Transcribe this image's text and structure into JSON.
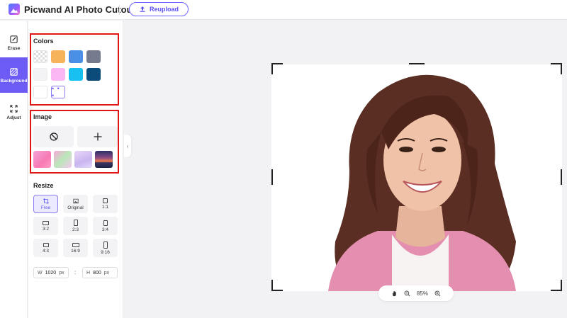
{
  "app": {
    "title": "Picwand AI Photo Cutout",
    "reupload_label": "Reupload"
  },
  "rail": [
    {
      "label": "Erase",
      "icon": "erase-icon"
    },
    {
      "label": "Background",
      "icon": "background-icon"
    },
    {
      "label": "Adjust",
      "icon": "adjust-icon"
    }
  ],
  "colors": {
    "title": "Colors",
    "swatches": [
      "transparent",
      "#f7b35c",
      "#4a8fe6",
      "#757b8c",
      "#f3f3f5",
      "#fbb7f3",
      "#17c0f0",
      "#0c4c7a",
      "#ffffff"
    ],
    "more_label": "• • •"
  },
  "image": {
    "title": "Image",
    "none_icon": "no-image-icon",
    "add_icon": "plus-icon",
    "thumbnails": [
      "pink-gradient",
      "pastel-gradient",
      "lavender-gradient",
      "sunset-photo"
    ]
  },
  "resize": {
    "title": "Resize",
    "options": [
      {
        "label": "Free",
        "active": true
      },
      {
        "label": "Original"
      },
      {
        "label": "1:1"
      },
      {
        "label": "3:2"
      },
      {
        "label": "2:3"
      },
      {
        "label": "3:4"
      },
      {
        "label": "4:3"
      },
      {
        "label": "16:9"
      },
      {
        "label": "9:16"
      }
    ],
    "width_label": "W",
    "width_value": "1020",
    "width_unit": "px",
    "separator": ":",
    "height_label": "H",
    "height_value": "800",
    "height_unit": "px"
  },
  "canvas": {
    "zoom": "85%"
  },
  "accent": "#6c5cf5",
  "highlight": "#e01515"
}
